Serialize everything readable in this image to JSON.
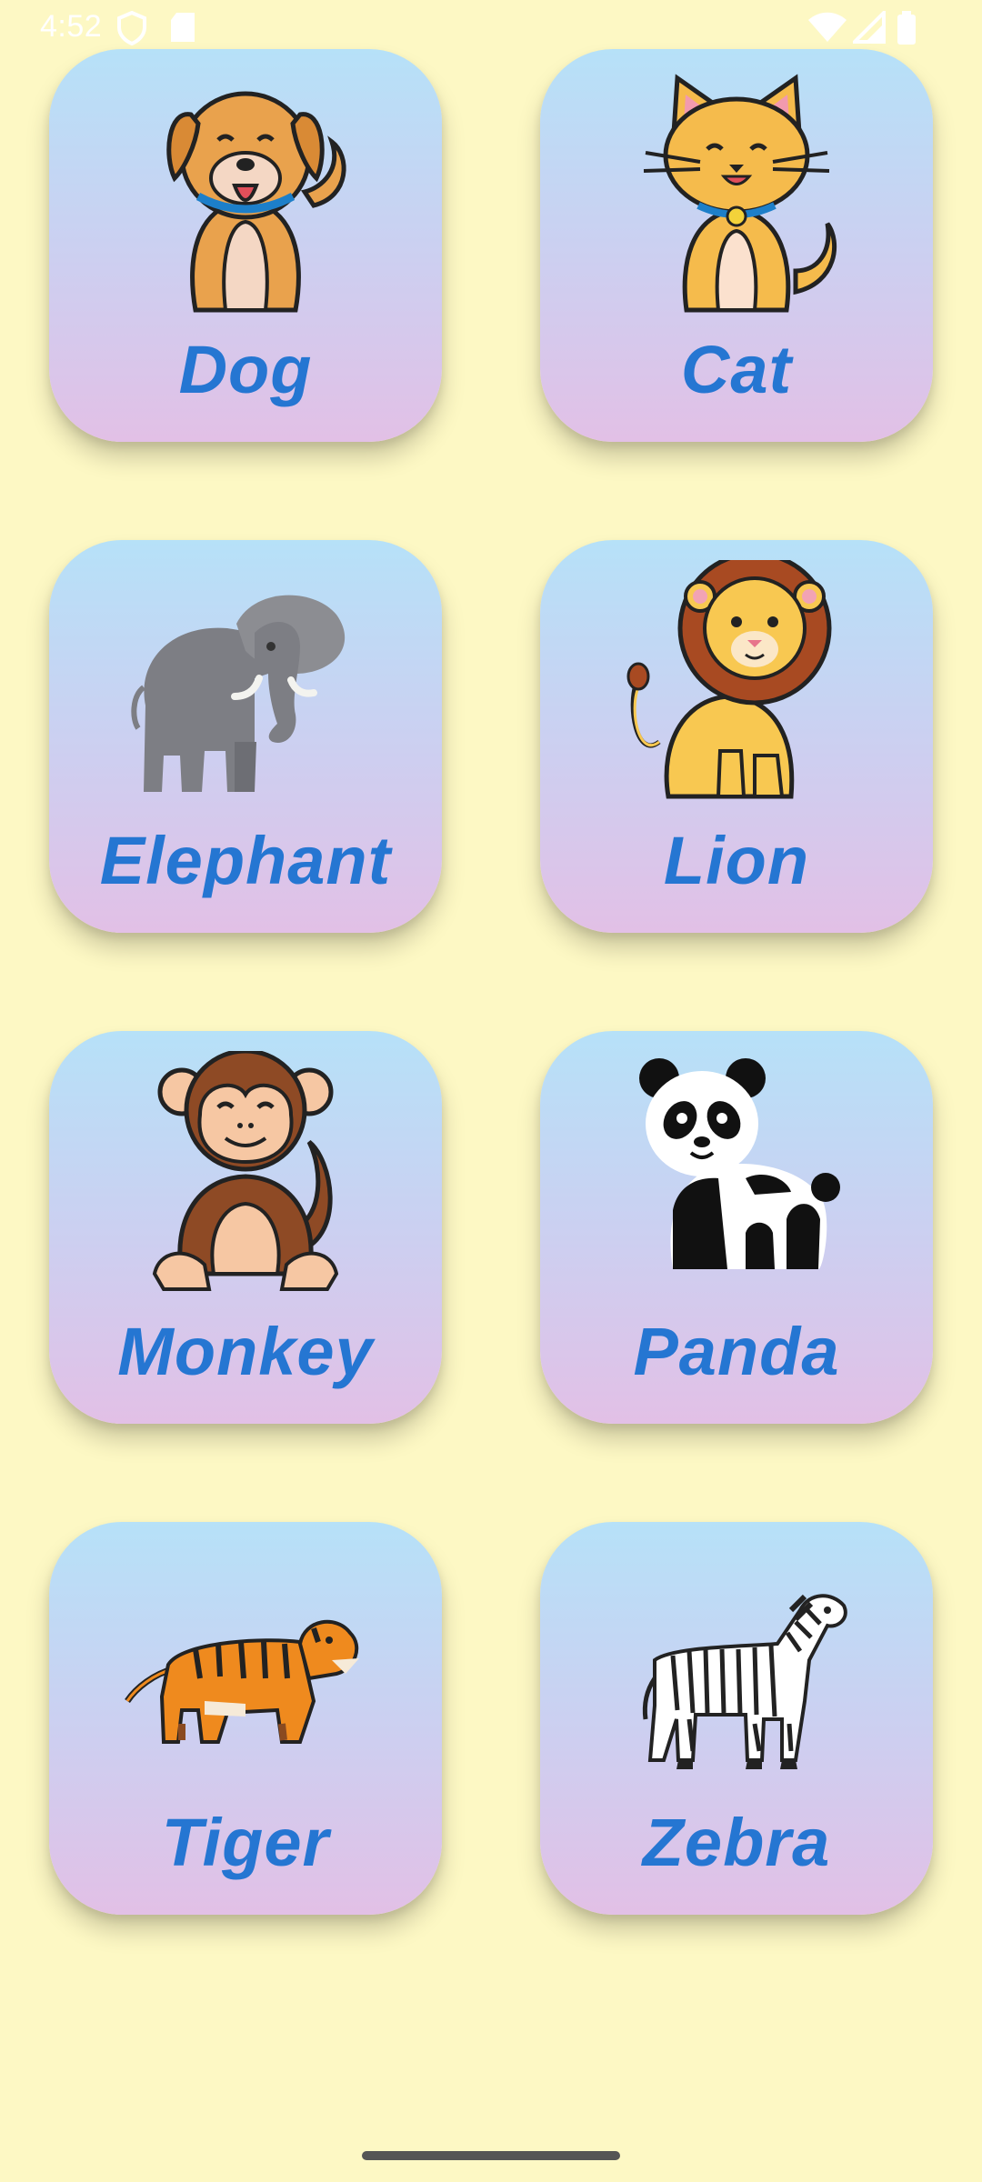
{
  "status_bar": {
    "time": "4:52",
    "icons_left": [
      "shield-icon",
      "sd-card-icon"
    ],
    "icons_right": [
      "wifi-icon",
      "signal-icon",
      "battery-icon"
    ]
  },
  "animals": [
    {
      "label": "Dog",
      "icon": "dog-icon"
    },
    {
      "label": "Cat",
      "icon": "cat-icon"
    },
    {
      "label": "Elephant",
      "icon": "elephant-icon"
    },
    {
      "label": "Lion",
      "icon": "lion-icon"
    },
    {
      "label": "Monkey",
      "icon": "monkey-icon"
    },
    {
      "label": "Panda",
      "icon": "panda-icon"
    },
    {
      "label": "Tiger",
      "icon": "tiger-icon"
    },
    {
      "label": "Zebra",
      "icon": "zebra-icon"
    }
  ],
  "colors": {
    "background": "#fdf8c4",
    "card_gradient_top": "#b6e1f8",
    "card_gradient_bottom": "#e2c0e6",
    "label": "#2576d2"
  }
}
